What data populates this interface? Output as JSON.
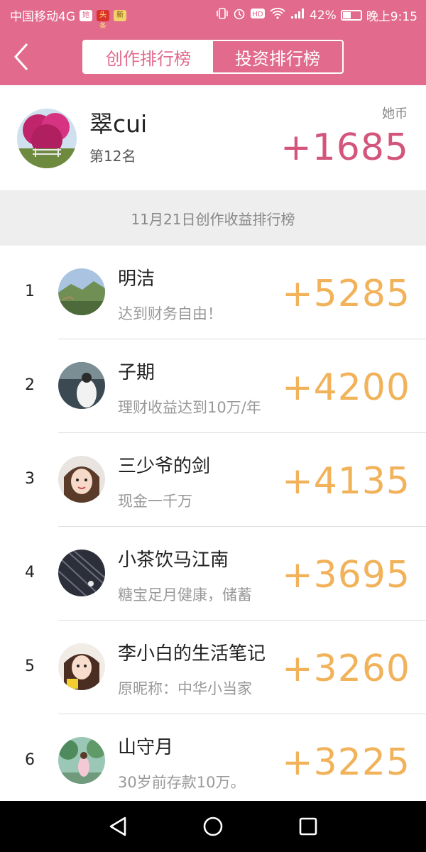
{
  "status_bar": {
    "carrier": "中国移动4G",
    "battery": "42%",
    "time": "晚上9:15",
    "chips": [
      "她",
      "头条",
      "新"
    ],
    "icons": [
      "vibrate-icon",
      "alarm-icon",
      "hd-icon",
      "wifi-icon",
      "signal-icon",
      "battery-icon"
    ]
  },
  "nav": {
    "tabs": [
      {
        "label": "创作排行榜",
        "active": true
      },
      {
        "label": "投资排行榜",
        "active": false
      }
    ]
  },
  "me": {
    "name": "翠cui",
    "rank": "第12名",
    "unit": "她币",
    "score": "+1685"
  },
  "section_title": "11月21日创作收益排行榜",
  "ranking": [
    {
      "rank": "1",
      "name": "明洁",
      "subtitle": "达到财务自由！",
      "score": "+5285"
    },
    {
      "rank": "2",
      "name": "子期",
      "subtitle": "理财收益达到10万/年",
      "score": "+4200"
    },
    {
      "rank": "3",
      "name": "三少爷的剑",
      "subtitle": "现金一千万",
      "score": "+4135"
    },
    {
      "rank": "4",
      "name": "小茶饮马江南",
      "subtitle": "糖宝足月健康，储蓄",
      "score": "+3695"
    },
    {
      "rank": "5",
      "name": "李小白的生活笔记",
      "subtitle": "原昵称：中华小当家",
      "score": "+3260"
    },
    {
      "rank": "6",
      "name": "山守月",
      "subtitle": "30岁前存款10万。",
      "score": "+3225"
    }
  ],
  "colors": {
    "brand": "#e16a8d",
    "my_score": "#d4557c",
    "rank_score": "#f1b25a"
  }
}
